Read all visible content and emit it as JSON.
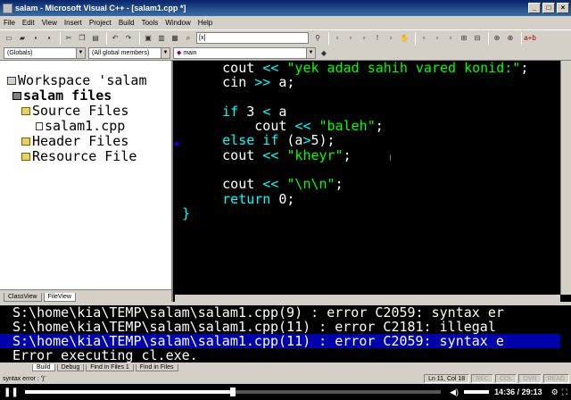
{
  "window": {
    "title": "salam - Microsoft Visual C++ - [salam1.cpp *]"
  },
  "menu": [
    "File",
    "Edit",
    "View",
    "Insert",
    "Project",
    "Build",
    "Tools",
    "Window",
    "Help"
  ],
  "toolbar": {
    "find_value": "[x]"
  },
  "wizard_bar": {
    "scope": "(Globals)",
    "members": "(All global members)",
    "function": "main"
  },
  "workspace": {
    "root": "Workspace 'salam",
    "project": "salam files",
    "folders": [
      "Source Files",
      "Header Files",
      "Resource File"
    ],
    "file": "salam1.cpp",
    "tabs": [
      "ClassView",
      "FileView"
    ]
  },
  "code_lines": [
    {
      "segs": [
        {
          "t": "cout ",
          "c": ""
        },
        {
          "t": "<<",
          "c": "op"
        },
        {
          "t": " \"yek adad sahih vared konid:\"",
          "c": "str"
        },
        {
          "t": ";",
          "c": ""
        }
      ]
    },
    {
      "segs": [
        {
          "t": "cin ",
          "c": ""
        },
        {
          "t": ">>",
          "c": "op"
        },
        {
          "t": " a;",
          "c": ""
        }
      ]
    },
    {
      "segs": [
        {
          "t": "",
          "c": ""
        }
      ]
    },
    {
      "segs": [
        {
          "t": "if",
          "c": "kw"
        },
        {
          "t": " 3 ",
          "c": ""
        },
        {
          "t": "<",
          "c": "op"
        },
        {
          "t": " a",
          "c": ""
        }
      ]
    },
    {
      "segs": [
        {
          "t": "    cout ",
          "c": ""
        },
        {
          "t": "<<",
          "c": "op"
        },
        {
          "t": " \"baleh\"",
          "c": "str"
        },
        {
          "t": ";",
          "c": ""
        }
      ]
    },
    {
      "segs": [
        {
          "t": "else if",
          "c": "kw"
        },
        {
          "t": " (a",
          "c": ""
        },
        {
          "t": ">",
          "c": "op"
        },
        {
          "t": "5);",
          "c": ""
        }
      ]
    },
    {
      "segs": [
        {
          "t": "cout ",
          "c": ""
        },
        {
          "t": "<<",
          "c": "op"
        },
        {
          "t": " \"kheyr\"",
          "c": "str"
        },
        {
          "t": ";",
          "c": ""
        }
      ]
    },
    {
      "segs": [
        {
          "t": "",
          "c": ""
        }
      ]
    },
    {
      "segs": [
        {
          "t": "cout ",
          "c": ""
        },
        {
          "t": "<<",
          "c": "op"
        },
        {
          "t": " \"\\n\\n\"",
          "c": "str"
        },
        {
          "t": ";",
          "c": ""
        }
      ]
    },
    {
      "segs": [
        {
          "t": "return",
          "c": "kw"
        },
        {
          "t": " 0;",
          "c": ""
        }
      ]
    }
  ],
  "closing_brace": "}",
  "output_lines": [
    "S:\\home\\kia\\TEMP\\salam\\salam1.cpp(9) : error C2059: syntax er",
    "S:\\home\\kia\\TEMP\\salam\\salam1.cpp(11) : error C2181: illegal",
    "S:\\home\\kia\\TEMP\\salam\\salam1.cpp(11) : error C2059: syntax e",
    "Error executing cl.exe."
  ],
  "output_tabs": [
    "Build",
    "Debug",
    "Find in Files 1",
    "Find in Files"
  ],
  "status": {
    "message": "syntax error : ')'",
    "position": "Ln 11, Col 18",
    "rec": "REC",
    "col": "COL",
    "ovr": "OVR",
    "read": "READ"
  },
  "player": {
    "time": "14:36 / 29:13",
    "progress": 0.5
  }
}
